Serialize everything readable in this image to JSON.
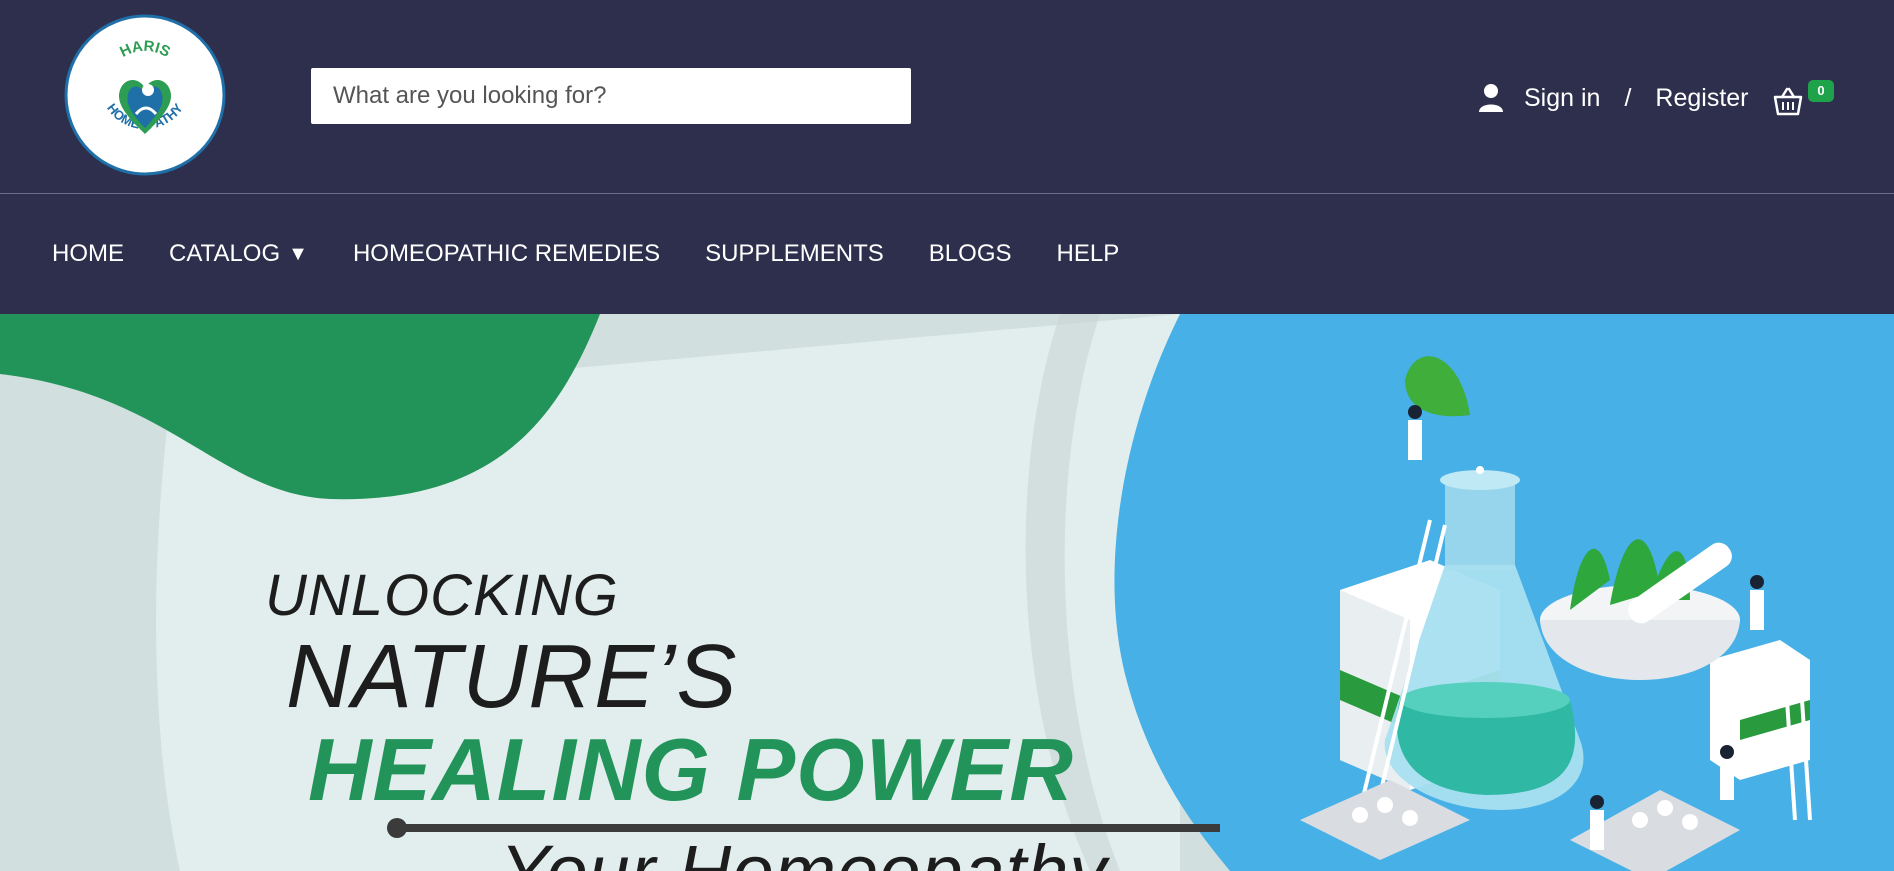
{
  "logo": {
    "text_top": "HARIS",
    "text_bottom": "HOMEOPATHY",
    "colors": {
      "blue": "#1f6fa8",
      "green": "#2c9d52"
    }
  },
  "search": {
    "placeholder": "What are you looking for?",
    "value": ""
  },
  "account": {
    "icon": "user-icon",
    "sign_in": "Sign in",
    "separator": "/",
    "register": "Register"
  },
  "cart": {
    "icon": "basket-icon",
    "count": "0",
    "badge_color": "#1fa34a"
  },
  "nav": {
    "items": [
      {
        "label": "HOME"
      },
      {
        "label": "CATALOG",
        "dropdown": true,
        "caret": "▼"
      },
      {
        "label": "HOMEOPATHIC REMEDIES"
      },
      {
        "label": "SUPPLEMENTS"
      },
      {
        "label": "BLOGS"
      },
      {
        "label": "HELP"
      }
    ]
  },
  "hero": {
    "line1": "UNLOCKING",
    "line2": "NATURE’S",
    "line3": "HEALING POWER",
    "line4": "Your Homeopathy",
    "colors": {
      "green": "#22945a",
      "blue": "#47b0e6",
      "light": "#e2eeee"
    }
  },
  "theme": {
    "header_bg": "#2e2f4c"
  }
}
